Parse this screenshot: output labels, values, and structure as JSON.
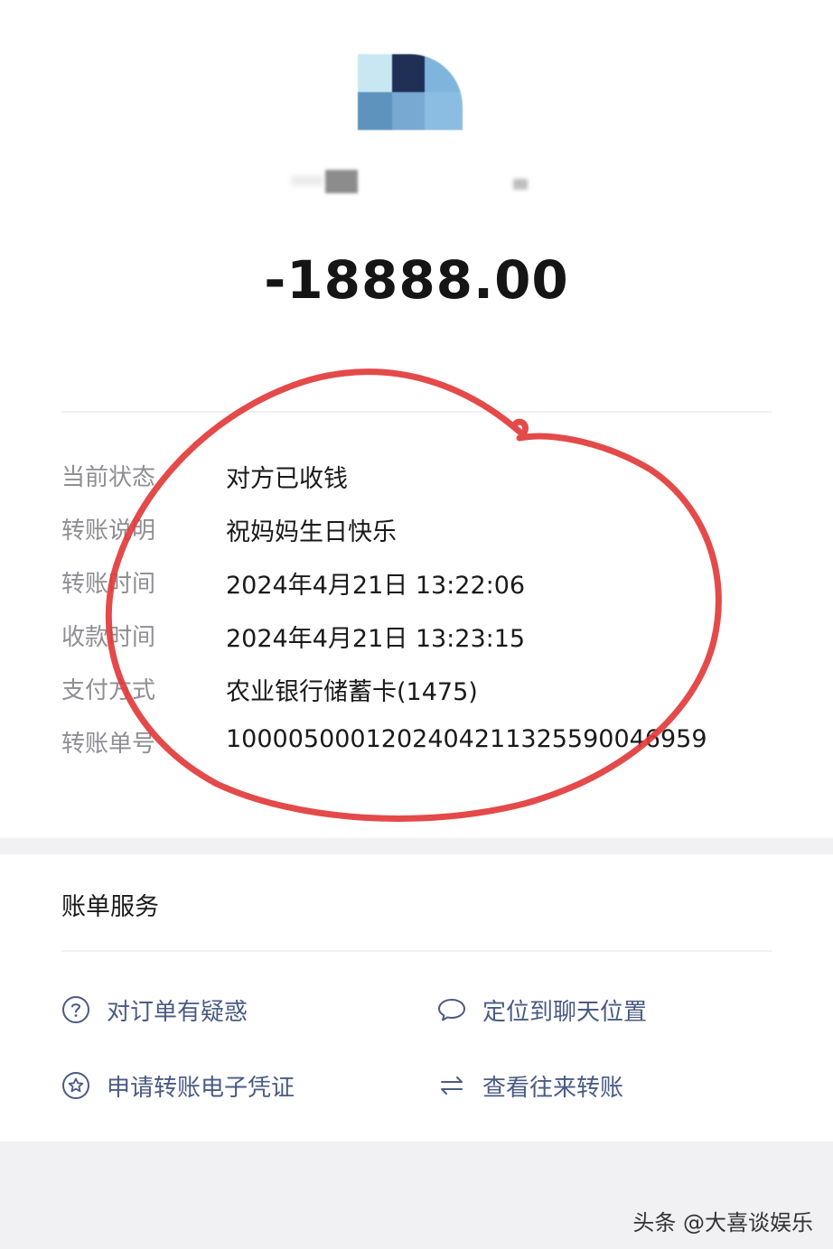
{
  "transfer": {
    "amount": "-18888.00",
    "details": [
      {
        "label": "当前状态",
        "value": "对方已收钱"
      },
      {
        "label": "转账说明",
        "value": "祝妈妈生日快乐"
      },
      {
        "label": "转账时间",
        "value": "2024年4月21日 13:22:06"
      },
      {
        "label": "收款时间",
        "value": "2024年4月21日 13:23:15"
      },
      {
        "label": "支付方式",
        "value": "农业银行储蓄卡(1475)"
      },
      {
        "label": "转账单号",
        "value": "1000050001202404211325590046959"
      }
    ]
  },
  "bill_services": {
    "title": "账单服务",
    "items": [
      {
        "label": "对订单有疑惑",
        "icon": "question-circle-icon"
      },
      {
        "label": "定位到聊天位置",
        "icon": "chat-bubble-icon"
      },
      {
        "label": "申请转账电子凭证",
        "icon": "star-badge-icon"
      },
      {
        "label": "查看往来转账",
        "icon": "exchange-arrows-icon"
      }
    ]
  },
  "watermark": "头条 @大喜谈娱乐",
  "colors": {
    "link_text": "#4a5b83",
    "annotation_circle": "#e23b3b",
    "label_gray": "#8e8e93"
  }
}
